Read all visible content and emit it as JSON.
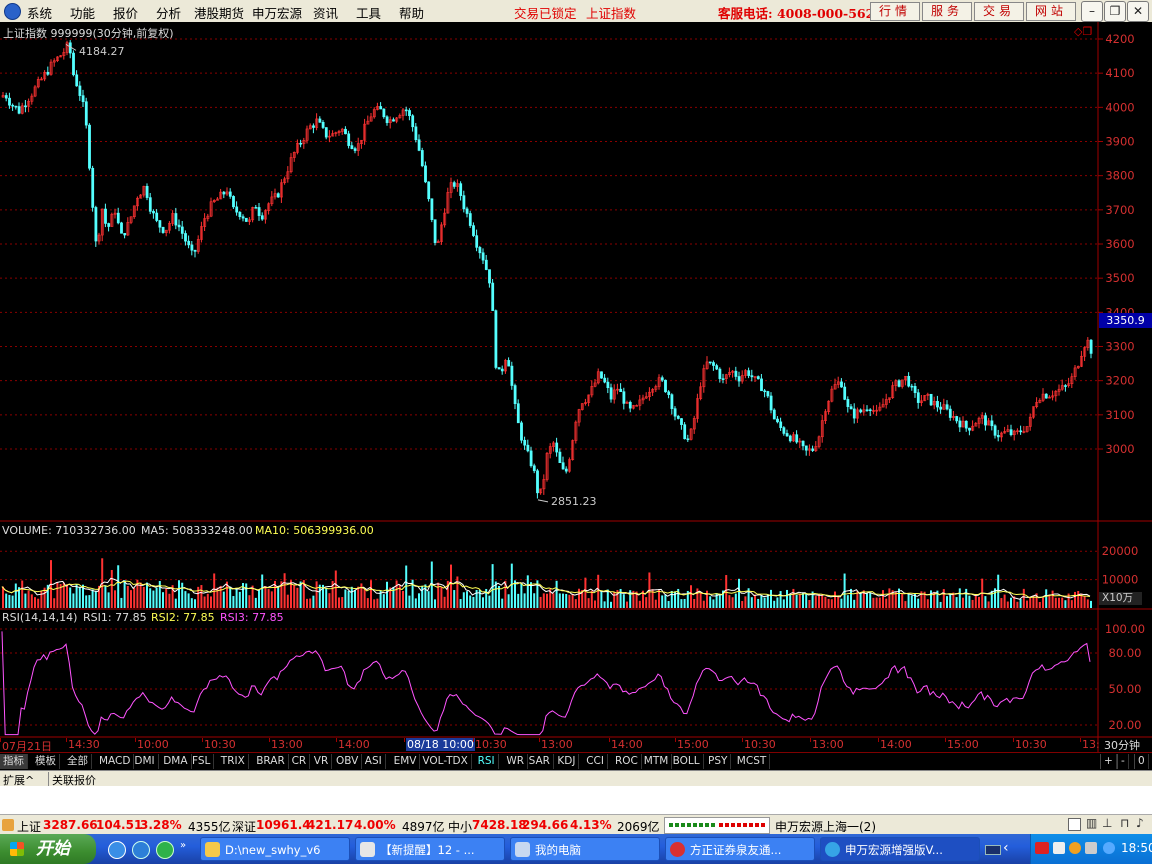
{
  "menubar": {
    "items": [
      "系统",
      "功能",
      "报价",
      "分析",
      "港股期货",
      "申万宏源",
      "资讯",
      "工具",
      "帮助"
    ],
    "lock_status": "交易已锁定",
    "current_index": "上证指数",
    "hotline": "客服电话: 4008-000-562",
    "buttons": [
      "行情",
      "服务",
      "交易",
      "网站"
    ]
  },
  "price_panel": {
    "header": "上证指数 999999(30分钟,前复权)",
    "high_label": "4184.27",
    "low_label": "2851.23",
    "current_price": "3350.9",
    "y_ticks": [
      "4200",
      "4100",
      "4000",
      "3900",
      "3800",
      "3700",
      "3600",
      "3500",
      "3400",
      "3300",
      "3200",
      "3100",
      "3000"
    ],
    "up_color": "#ff3232",
    "down_color": "#54ffff"
  },
  "volume_panel": {
    "label": "VOLUME: 710332736.00",
    "ma5": "MA5: 508333248.00",
    "ma10": "MA10: 506399936.00",
    "y_ticks": [
      "20000",
      "10000"
    ],
    "unit": "X10万"
  },
  "rsi_panel": {
    "label": "RSI(14,14,14)",
    "rsi1": "RSI1: 77.85",
    "rsi2": "RSI2: 77.85",
    "rsi3": "RSI3: 77.85",
    "y_ticks": [
      "100.00",
      "80.00",
      "50.00",
      "20.00"
    ]
  },
  "time_axis": {
    "labels": [
      "07月21日",
      "14:30",
      "10:00",
      "10:30",
      "13:00",
      "14:00",
      "08/18 10:00",
      "10:30",
      "13:00",
      "14:00",
      "15:00",
      "10:30",
      "13:00",
      "14:00",
      "15:00",
      "10:30",
      "13:"
    ],
    "period": "30分钟"
  },
  "indicator_tabs": [
    "指标",
    "模板",
    "全部",
    "MACD",
    "DMI",
    "DMA",
    "FSL",
    "TRIX",
    "BRAR",
    "CR",
    "VR",
    "OBV",
    "ASI",
    "EMV",
    "VOL-TDX",
    "RSI",
    "WR",
    "SAR",
    "KDJ",
    "CCI",
    "ROC",
    "MTM",
    "BOLL",
    "PSY",
    "MCST"
  ],
  "tab_controls": [
    "+",
    "-",
    "0"
  ],
  "ext_tabs": [
    "扩展^",
    "关联报价"
  ],
  "status_bar": {
    "sh_name": "上证",
    "sh_value": "3287.66",
    "sh_change": "104.51",
    "sh_pct": "3.28%",
    "sh_amount": "4355亿",
    "sz_name": "深证",
    "sz_value": "10961.4",
    "sz_change": "421.17",
    "sz_pct": "4.00%",
    "sz_amount": "4897亿",
    "zx_name": "中小",
    "zx_value": "7428.18",
    "zx_change": "294.66",
    "zx_pct": "4.13%",
    "zx_amount": "2069亿",
    "server": "申万宏源上海一(2)"
  },
  "taskbar": {
    "start": "开始",
    "tasks": [
      "D:\\new_swhy_v6",
      "【新提醒】12 - ...",
      "我的电脑",
      "方正证券泉友通...",
      "申万宏源增强版V..."
    ],
    "clock": "18:50"
  },
  "chart_data": {
    "type": "candlestick",
    "title": "上证指数 999999(30分钟,前复权)",
    "ylim": [
      2800,
      4230
    ],
    "price_path": [
      [
        0,
        4030
      ],
      [
        4,
        4040
      ],
      [
        10,
        4010
      ],
      [
        18,
        3990
      ],
      [
        28,
        4030
      ],
      [
        40,
        4080
      ],
      [
        52,
        4130
      ],
      [
        62,
        4160
      ],
      [
        68,
        4184.27
      ],
      [
        72,
        4100
      ],
      [
        78,
        4050
      ],
      [
        84,
        3980
      ],
      [
        88,
        3850
      ],
      [
        92,
        3700
      ],
      [
        96,
        3560
      ],
      [
        100,
        3720
      ],
      [
        106,
        3640
      ],
      [
        114,
        3700
      ],
      [
        120,
        3620
      ],
      [
        128,
        3660
      ],
      [
        136,
        3740
      ],
      [
        144,
        3770
      ],
      [
        150,
        3700
      ],
      [
        156,
        3660
      ],
      [
        164,
        3640
      ],
      [
        172,
        3680
      ],
      [
        180,
        3640
      ],
      [
        186,
        3600
      ],
      [
        192,
        3560
      ],
      [
        198,
        3620
      ],
      [
        204,
        3680
      ],
      [
        212,
        3720
      ],
      [
        220,
        3740
      ],
      [
        226,
        3760
      ],
      [
        232,
        3700
      ],
      [
        240,
        3690
      ],
      [
        248,
        3660
      ],
      [
        254,
        3720
      ],
      [
        260,
        3680
      ],
      [
        268,
        3720
      ],
      [
        276,
        3740
      ],
      [
        284,
        3800
      ],
      [
        292,
        3860
      ],
      [
        300,
        3900
      ],
      [
        308,
        3940
      ],
      [
        316,
        3960
      ],
      [
        324,
        3920
      ],
      [
        332,
        3920
      ],
      [
        340,
        3940
      ],
      [
        348,
        3900
      ],
      [
        356,
        3880
      ],
      [
        364,
        3940
      ],
      [
        372,
        3990
      ],
      [
        380,
        3990
      ],
      [
        388,
        3960
      ],
      [
        396,
        3980
      ],
      [
        404,
        4000
      ],
      [
        410,
        3960
      ],
      [
        416,
        3900
      ],
      [
        420,
        3850
      ],
      [
        424,
        3780
      ],
      [
        428,
        3720
      ],
      [
        432,
        3640
      ],
      [
        436,
        3580
      ],
      [
        440,
        3650
      ],
      [
        446,
        3740
      ],
      [
        452,
        3780
      ],
      [
        458,
        3760
      ],
      [
        464,
        3700
      ],
      [
        470,
        3660
      ],
      [
        476,
        3600
      ],
      [
        482,
        3560
      ],
      [
        486,
        3520
      ],
      [
        489,
        3490
      ],
      [
        492,
        3380
      ],
      [
        494,
        3260
      ],
      [
        498,
        3220
      ],
      [
        502,
        3240
      ],
      [
        506,
        3290
      ],
      [
        510,
        3200
      ],
      [
        514,
        3120
      ],
      [
        518,
        3060
      ],
      [
        524,
        3000
      ],
      [
        530,
        2960
      ],
      [
        534,
        2920
      ],
      [
        538,
        2851.23
      ],
      [
        542,
        2900
      ],
      [
        546,
        2980
      ],
      [
        552,
        3020
      ],
      [
        558,
        2960
      ],
      [
        564,
        2920
      ],
      [
        570,
        3000
      ],
      [
        574,
        3080
      ],
      [
        580,
        3140
      ],
      [
        586,
        3150
      ],
      [
        592,
        3180
      ],
      [
        598,
        3220
      ],
      [
        604,
        3190
      ],
      [
        610,
        3150
      ],
      [
        616,
        3180
      ],
      [
        622,
        3150
      ],
      [
        628,
        3110
      ],
      [
        636,
        3120
      ],
      [
        644,
        3160
      ],
      [
        652,
        3190
      ],
      [
        660,
        3200
      ],
      [
        668,
        3160
      ],
      [
        674,
        3100
      ],
      [
        680,
        3060
      ],
      [
        688,
        3020
      ],
      [
        694,
        3100
      ],
      [
        700,
        3200
      ],
      [
        706,
        3250
      ],
      [
        714,
        3240
      ],
      [
        722,
        3200
      ],
      [
        730,
        3230
      ],
      [
        738,
        3210
      ],
      [
        746,
        3230
      ],
      [
        754,
        3200
      ],
      [
        762,
        3180
      ],
      [
        768,
        3140
      ],
      [
        774,
        3080
      ],
      [
        780,
        3060
      ],
      [
        788,
        3040
      ],
      [
        796,
        3020
      ],
      [
        804,
        2990
      ],
      [
        812,
        3000
      ],
      [
        818,
        3040
      ],
      [
        824,
        3120
      ],
      [
        832,
        3180
      ],
      [
        840,
        3200
      ],
      [
        846,
        3120
      ],
      [
        852,
        3100
      ],
      [
        860,
        3110
      ],
      [
        868,
        3130
      ],
      [
        876,
        3100
      ],
      [
        884,
        3140
      ],
      [
        892,
        3180
      ],
      [
        900,
        3200
      ],
      [
        906,
        3210
      ],
      [
        912,
        3160
      ],
      [
        918,
        3140
      ],
      [
        926,
        3150
      ],
      [
        934,
        3130
      ],
      [
        942,
        3120
      ],
      [
        950,
        3100
      ],
      [
        958,
        3080
      ],
      [
        966,
        3060
      ],
      [
        974,
        3080
      ],
      [
        982,
        3090
      ],
      [
        990,
        3060
      ],
      [
        998,
        3040
      ],
      [
        1006,
        3050
      ],
      [
        1014,
        3040
      ],
      [
        1022,
        3060
      ],
      [
        1028,
        3070
      ],
      [
        1034,
        3140
      ],
      [
        1040,
        3160
      ],
      [
        1048,
        3160
      ],
      [
        1056,
        3170
      ],
      [
        1064,
        3180
      ],
      [
        1070,
        3200
      ],
      [
        1074,
        3230
      ],
      [
        1078,
        3260
      ],
      [
        1082,
        3300
      ],
      [
        1086,
        3320
      ],
      [
        1090,
        3290
      ]
    ],
    "volume_ylim": [
      0,
      25000
    ],
    "rsi_ylim": [
      10,
      105
    ]
  }
}
